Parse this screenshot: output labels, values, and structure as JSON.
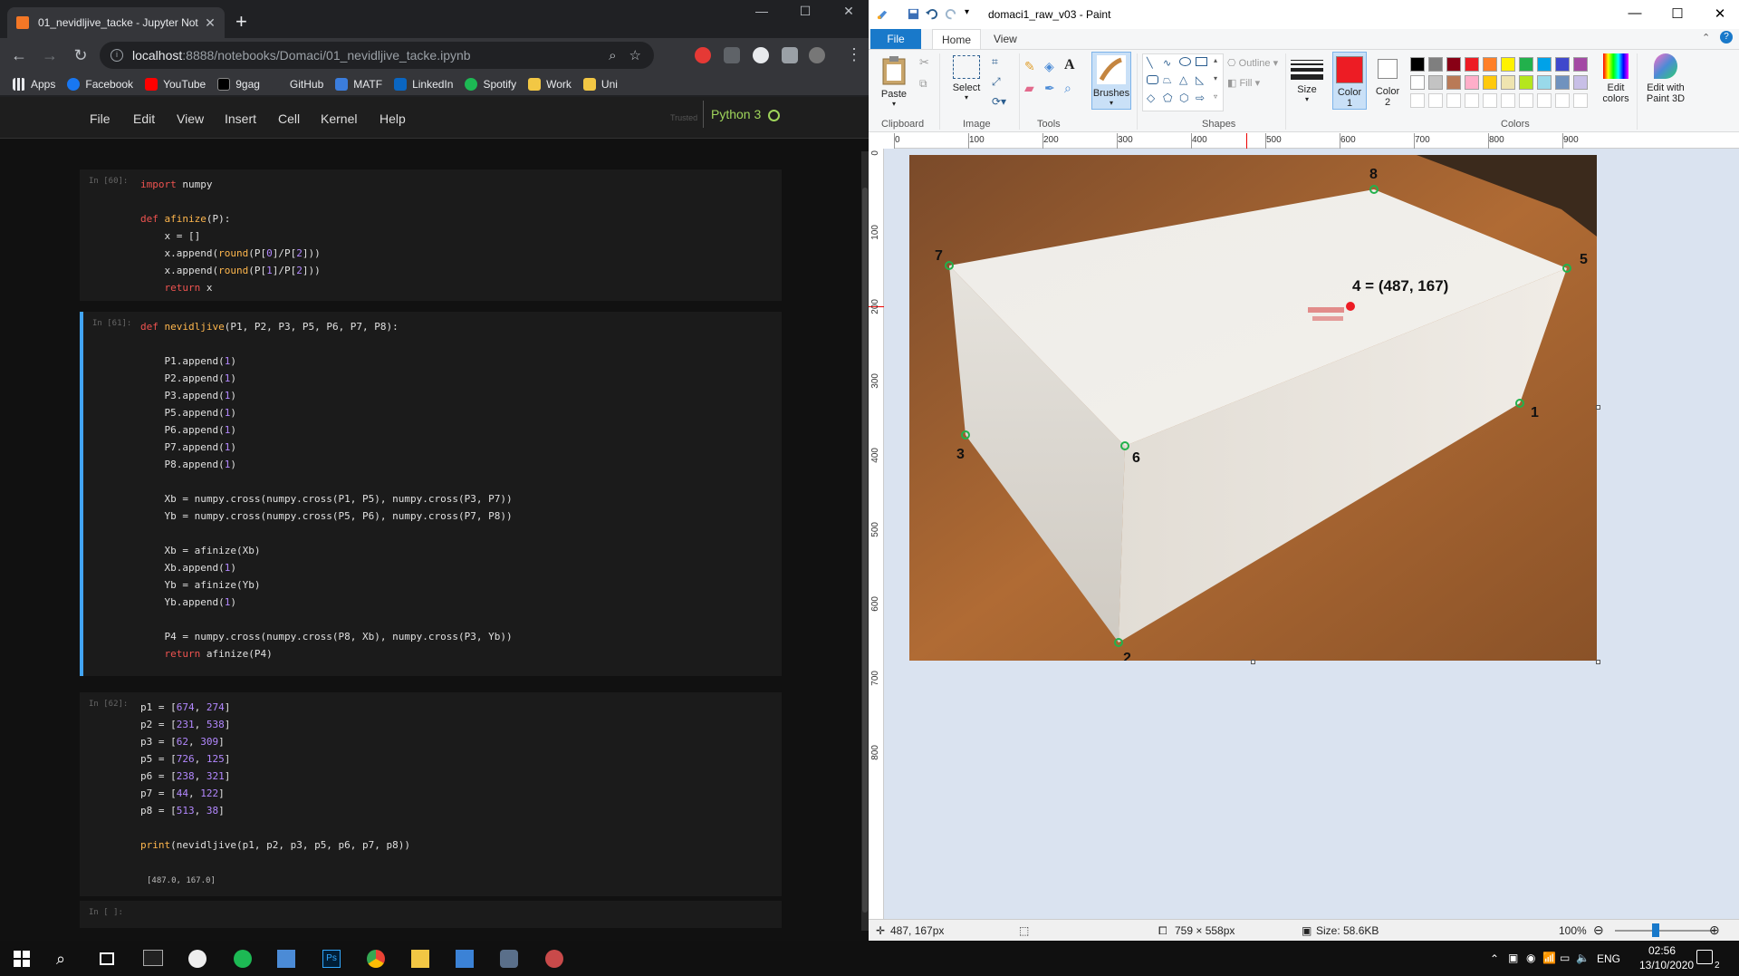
{
  "chrome": {
    "tab_title": "01_nevidljive_tacke - Jupyter Not",
    "tab_close": "✕",
    "new_tab": "+",
    "url_host": "localhost",
    "url_path": ":8888/notebooks/Domaci/01_nevidljive_tacke.ipynb",
    "bookmarks": [
      "Apps",
      "Facebook",
      "YouTube",
      "9gag",
      "GitHub",
      "MATF",
      "LinkedIn",
      "Spotify",
      "Work",
      "Uni"
    ]
  },
  "jupyter": {
    "menu": [
      "File",
      "Edit",
      "View",
      "Insert",
      "Cell",
      "Kernel",
      "Help"
    ],
    "trusted": "Trusted",
    "kernel": "Python 3",
    "cells": [
      {
        "prompt": "In [60]:"
      },
      {
        "prompt": "In [61]:"
      },
      {
        "prompt": "In [62]:"
      },
      {
        "prompt": "In [ ]:"
      }
    ],
    "output": "[487.0, 167.0]"
  },
  "paint": {
    "title": "domaci1_raw_v03 - Paint",
    "tabs": {
      "file": "File",
      "home": "Home",
      "view": "View"
    },
    "groups": {
      "clipboard": "Clipboard",
      "image": "Image",
      "tools": "Tools",
      "shapes": "Shapes",
      "colors": "Colors"
    },
    "buttons": {
      "paste": "Paste",
      "select": "Select",
      "brushes": "Brushes",
      "size": "Size",
      "color1": "Color\n1",
      "color2": "Color\n2",
      "edit_colors": "Edit\ncolors",
      "edit_3d": "Edit with\nPaint 3D",
      "outline": "Outline",
      "fill": "Fill"
    },
    "ruler_h": [
      "0",
      "100",
      "200",
      "300",
      "400",
      "500",
      "600",
      "700",
      "800",
      "900"
    ],
    "ruler_v": [
      "0",
      "100",
      "200",
      "300",
      "400",
      "500",
      "600",
      "700",
      "800"
    ],
    "palette": [
      "#000000",
      "#7f7f7f",
      "#880015",
      "#ed1c24",
      "#ff7f27",
      "#fff200",
      "#22b14c",
      "#00a2e8",
      "#3f48cc",
      "#a349a4",
      "#ffffff",
      "#c3c3c3",
      "#b97a57",
      "#ffaec9",
      "#ffc90e",
      "#efe4b0",
      "#b5e61d",
      "#99d9ea",
      "#7092be",
      "#c8bfe7"
    ],
    "color1": "#ed1c24",
    "color2": "#ffffff",
    "labels": {
      "p1": "1",
      "p2": "2",
      "p3": "3",
      "p4": "4 = (487, 167)",
      "p5": "5",
      "p6": "6",
      "p7": "7",
      "p8": "8"
    },
    "status": {
      "cursor": "487, 167px",
      "dimensions": "759 × 558px",
      "size": "Size: 58.6KB",
      "zoom": "100%"
    }
  },
  "taskbar": {
    "lang": "ENG",
    "time": "02:56",
    "date": "13/10/2020",
    "notif": "2"
  }
}
